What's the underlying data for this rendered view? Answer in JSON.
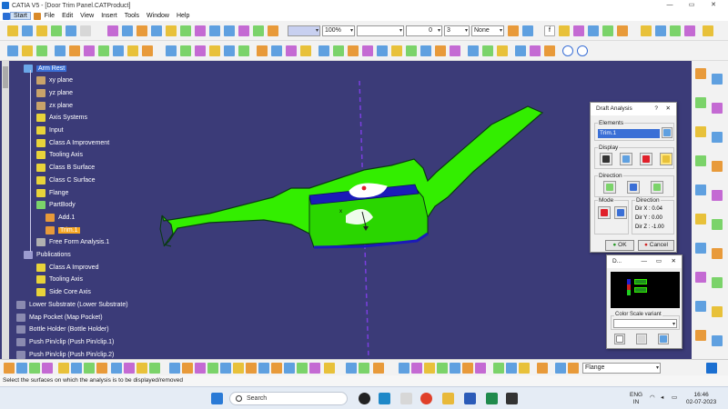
{
  "window": {
    "title": "CATIA V5 - [Door Trim Panel.CATProduct]",
    "controls": [
      "—",
      "▭",
      "✕"
    ]
  },
  "menu": [
    "Start",
    "File",
    "Edit",
    "View",
    "Insert",
    "Tools",
    "Window",
    "Help"
  ],
  "toolbar": {
    "zoom": "100%",
    "pattern": "",
    "linetype": "",
    "layer": "0",
    "linewidth": "None",
    "points_count": "3"
  },
  "tree": [
    {
      "label": "Arm Rest",
      "level": 1,
      "selected": true,
      "icon_color": "#6aa7e8"
    },
    {
      "label": "xy plane",
      "level": 2,
      "icon_color": "#c9a36a"
    },
    {
      "label": "yz plane",
      "level": 2,
      "icon_color": "#c9a36a"
    },
    {
      "label": "zx plane",
      "level": 2,
      "icon_color": "#c9a36a"
    },
    {
      "label": "Axis Systems",
      "level": 2,
      "icon_color": "#e8d33a"
    },
    {
      "label": "Input",
      "level": 2,
      "icon_color": "#e8d33a"
    },
    {
      "label": "Class A Improvement",
      "level": 2,
      "icon_color": "#e8d33a"
    },
    {
      "label": "Tooling Axis",
      "level": 2,
      "icon_color": "#e8d33a"
    },
    {
      "label": "Class B Surface",
      "level": 2,
      "icon_color": "#e8d33a"
    },
    {
      "label": "Class C Surface",
      "level": 2,
      "icon_color": "#e8d33a"
    },
    {
      "label": "Flange",
      "level": 2,
      "icon_color": "#e8d33a"
    },
    {
      "label": "PartBody",
      "level": 2,
      "icon_color": "#7bd36a"
    },
    {
      "label": "Add.1",
      "level": 3,
      "icon_color": "#e89a3a"
    },
    {
      "label": "Trim.1",
      "level": 3,
      "highlight": true,
      "icon_color": "#e89a3a"
    },
    {
      "label": "Free Form Analysis.1",
      "level": 2,
      "icon_color": "#b0b0b0"
    },
    {
      "label": "Publications",
      "level": 1,
      "icon_color": "#9b9bd0"
    },
    {
      "label": "Class A Improved",
      "level": 2,
      "icon_color": "#e8d33a"
    },
    {
      "label": "Tooling Axis",
      "level": 2,
      "icon_color": "#e8d33a"
    },
    {
      "label": "Side Core Axis",
      "level": 2,
      "icon_color": "#e8d33a"
    },
    {
      "label": "Lower Substrate (Lower Substrate)",
      "level": 0,
      "icon_color": "#8a8ab0"
    },
    {
      "label": "Map Pocket (Map Pocket)",
      "level": 0,
      "icon_color": "#8a8ab0"
    },
    {
      "label": "Bottle Holder (Bottle Holder)",
      "level": 0,
      "icon_color": "#8a8ab0"
    },
    {
      "label": "Push Pin/clip (Push Pin/clip.1)",
      "level": 0,
      "icon_color": "#8a8ab0"
    },
    {
      "label": "Push Pin/clip (Push Pin/clip.2)",
      "level": 0,
      "icon_color": "#8a8ab0"
    }
  ],
  "draft_dialog": {
    "title": "Draft Analysis",
    "help": "?",
    "close": "✕",
    "elements_label": "Elements",
    "element_value": "Trim.1",
    "display_label": "Display",
    "direction_label": "Direction",
    "mode_label": "Mode",
    "direction_box_label": "Direction",
    "dir_x": "Dir X :  0.04",
    "dir_y": "Dir Y :  0.00",
    "dir_z": "Dir Z :  -1.00",
    "ok": "OK",
    "cancel": "Cancel"
  },
  "scale_dialog": {
    "title": "D...",
    "minimize": "—",
    "maximize": "▭",
    "close": "✕",
    "variant_label": "Color Scale variant",
    "variant_value": "",
    "scale_values": [
      "",
      ""
    ]
  },
  "bottom": {
    "layer_value": "Flange"
  },
  "status": {
    "text": "Select the surfaces on which the analysis is to be displayed/removed"
  },
  "taskbar": {
    "search": "Search",
    "lang_top": "ENG",
    "lang_bottom": "IN",
    "time": "16:46",
    "date": "02-07-2023"
  },
  "colors": {
    "viewport_bg": "#3b3b78",
    "part_green": "#33ee00",
    "accent_blue": "#3a6fd6"
  }
}
